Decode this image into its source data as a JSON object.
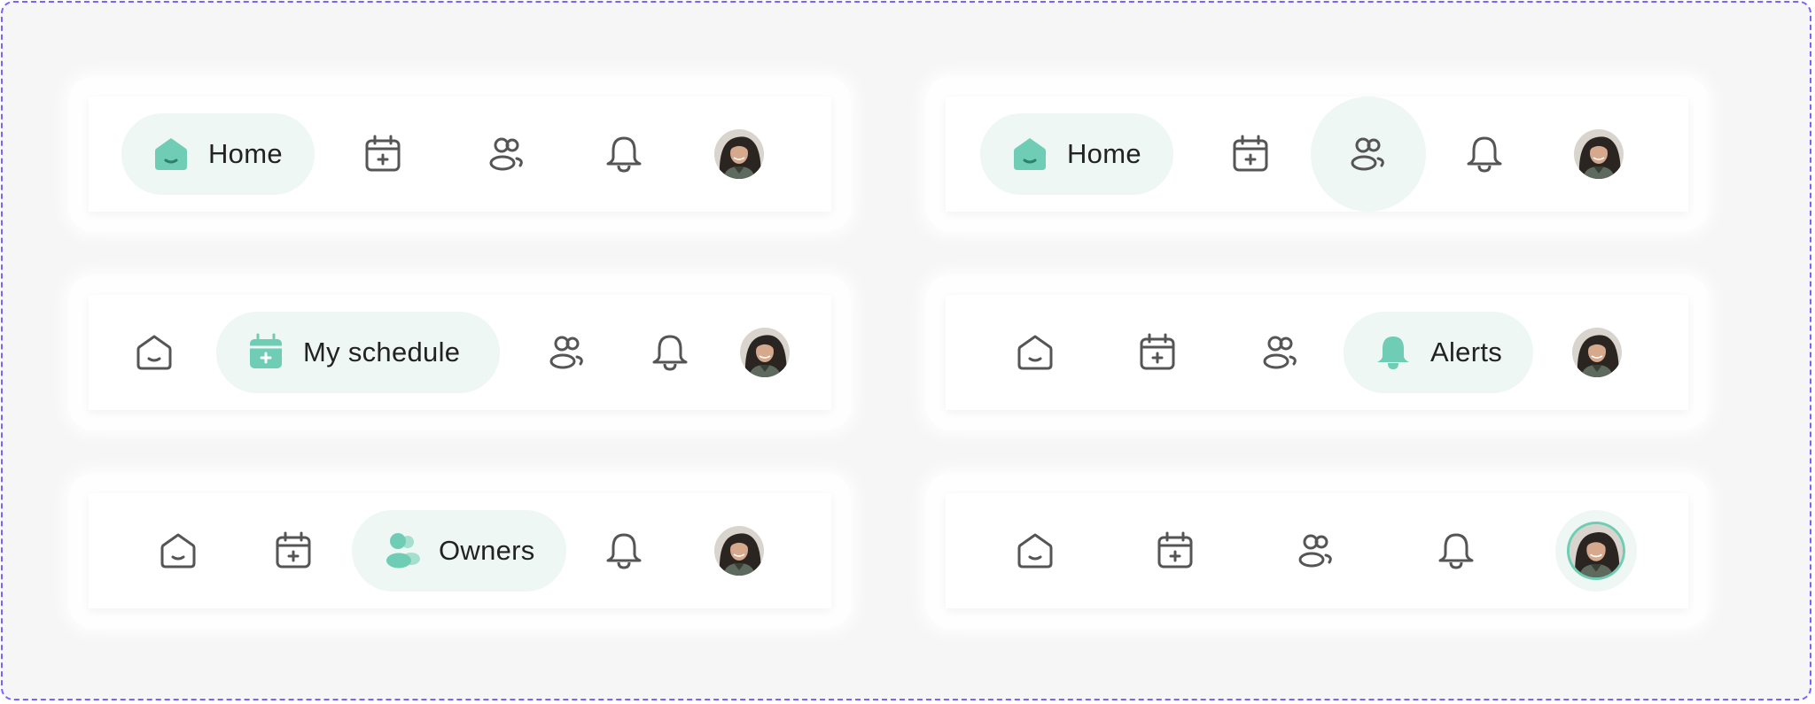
{
  "colors": {
    "accent": "#6ecdb4",
    "pill_background": "#eef7f4",
    "icon_stroke": "#555555",
    "frame_border": "#7b61ff"
  },
  "labels": {
    "home": "Home",
    "schedule": "My schedule",
    "owners": "Owners",
    "alerts": "Alerts"
  },
  "variants": [
    {
      "active": "home",
      "hover": ""
    },
    {
      "active": "home",
      "hover": "owners"
    },
    {
      "active": "schedule",
      "hover": ""
    },
    {
      "active": "alerts",
      "hover": ""
    },
    {
      "active": "owners",
      "hover": ""
    },
    {
      "active": "profile",
      "hover": ""
    }
  ],
  "icons": {
    "home": "house-smile-icon",
    "schedule": "calendar-plus-icon",
    "owners": "users-icon",
    "alerts": "bell-icon",
    "profile": "avatar"
  }
}
